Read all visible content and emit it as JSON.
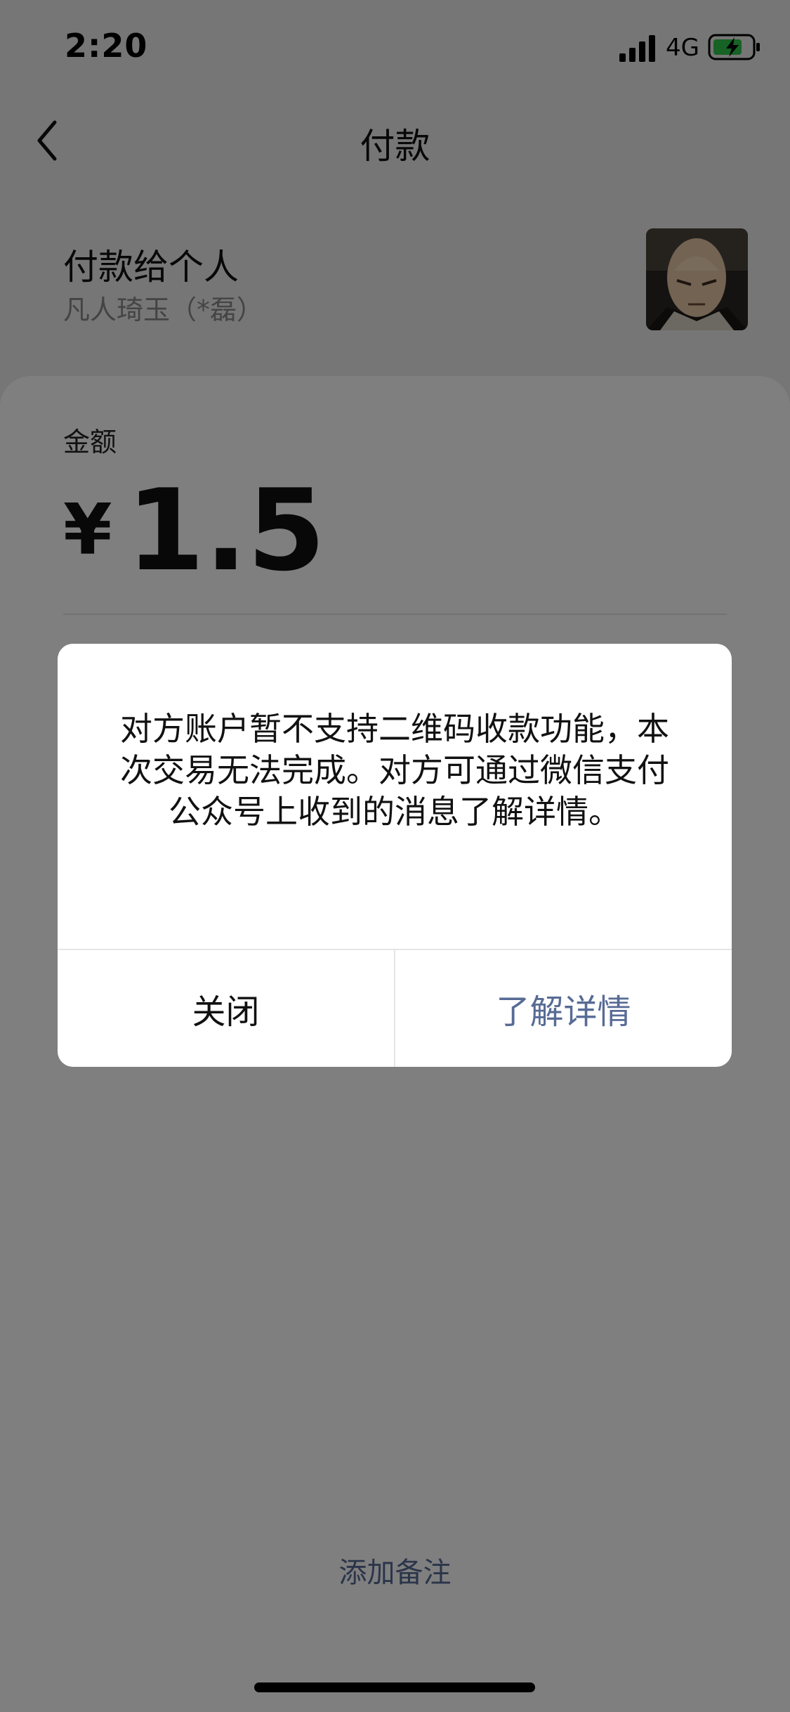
{
  "status_bar": {
    "time": "2:20",
    "network": "4G",
    "icons": [
      "signal-icon",
      "battery-charging-icon"
    ]
  },
  "nav": {
    "title": "付款",
    "back_icon": "chevron-left-icon"
  },
  "payee": {
    "label": "付款给个人",
    "name": "凡人琦玉（*磊）"
  },
  "amount": {
    "label": "金额",
    "currency": "¥",
    "value": "1.5"
  },
  "remark": {
    "label": "添加备注"
  },
  "dialog": {
    "message": "对方账户暂不支持二维码收款功能，本次交易无法完成。对方可通过微信支付公众号上收到的消息了解详情。",
    "cancel_label": "关闭",
    "confirm_label": "了解详情"
  },
  "colors": {
    "link": "#576b95",
    "background": "#ededed",
    "overlay": "rgba(0,0,0,0.5)"
  }
}
